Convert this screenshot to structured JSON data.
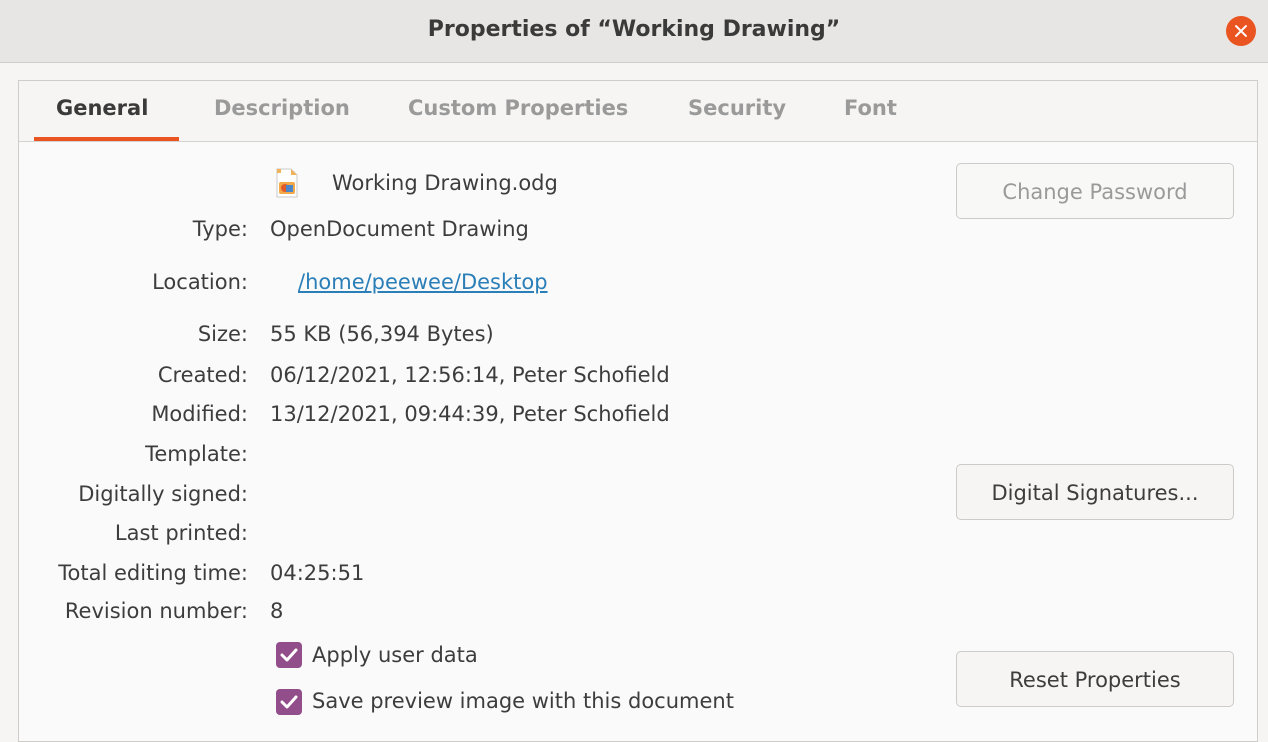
{
  "window": {
    "title": "Properties of “Working Drawing”"
  },
  "tabs": [
    {
      "label": "General",
      "active": true
    },
    {
      "label": "Description",
      "active": false
    },
    {
      "label": "Custom Properties",
      "active": false
    },
    {
      "label": "Security",
      "active": false
    },
    {
      "label": "Font",
      "active": false
    }
  ],
  "general": {
    "file_name": "Working Drawing.odg",
    "file_icon": "odg-file-icon",
    "type_label": "Type:",
    "type_value": "OpenDocument Drawing",
    "location_label": "Location:",
    "location_value": "/home/peewee/Desktop",
    "size_label": "Size:",
    "size_value": "55 KB (56,394 Bytes)",
    "created_label": "Created:",
    "created_value": "06/12/2021, 12:56:14, Peter Schofield",
    "modified_label": "Modified:",
    "modified_value": "13/12/2021, 09:44:39, Peter Schofield",
    "template_label": "Template:",
    "template_value": "",
    "signed_label": "Digitally signed:",
    "signed_value": "",
    "printed_label": "Last printed:",
    "printed_value": "",
    "editing_label": "Total editing time:",
    "editing_value": "04:25:51",
    "revision_label": "Revision number:",
    "revision_value": "8"
  },
  "buttons": {
    "change_password": "Change Password",
    "digital_signatures": "Digital Signatures...",
    "reset_properties": "Reset Properties"
  },
  "options": [
    {
      "label": "Apply user data",
      "checked": true
    },
    {
      "label": "Save preview image with this document",
      "checked": true
    }
  ],
  "colors": {
    "accent": "#e95420",
    "checkbox": "#924d8b",
    "link": "#2a7fb8"
  }
}
